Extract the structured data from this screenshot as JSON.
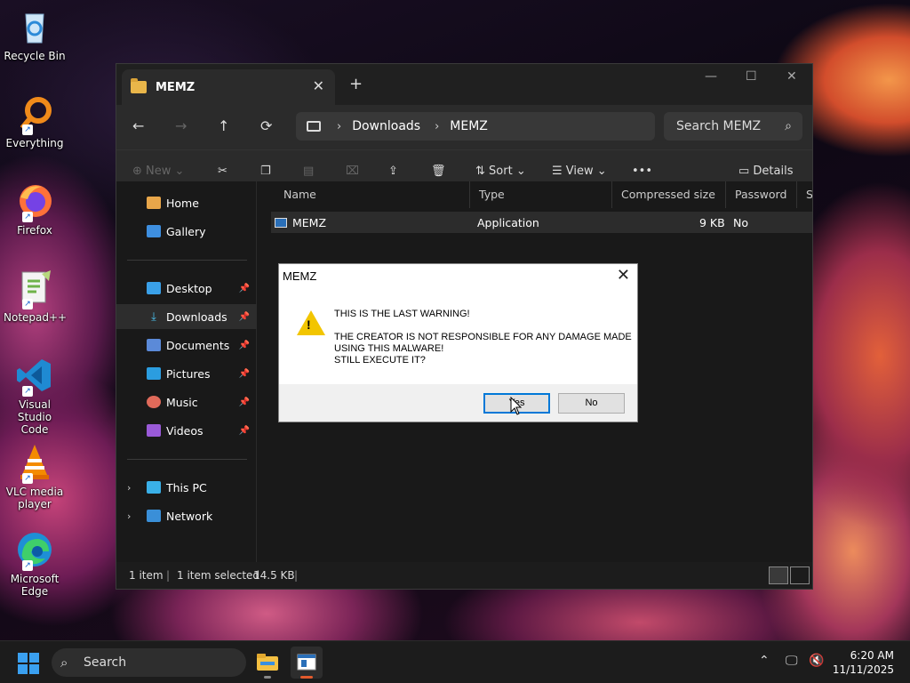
{
  "desktop": {
    "icons": [
      {
        "label": "Recycle Bin",
        "icon": "recycle-bin-icon"
      },
      {
        "label": "Everything",
        "icon": "everything-search-icon"
      },
      {
        "label": "Firefox",
        "icon": "firefox-icon"
      },
      {
        "label": "Notepad++",
        "icon": "notepad-plus-plus-icon"
      },
      {
        "label": "Visual Studio Code",
        "icon": "vscode-icon"
      },
      {
        "label": "VLC media player",
        "icon": "vlc-icon"
      },
      {
        "label": "Microsoft Edge",
        "icon": "edge-icon"
      }
    ]
  },
  "explorer": {
    "tab_title": "MEMZ",
    "new_tab": "+",
    "nav": {
      "back": "←",
      "forward": "→",
      "up": "↑",
      "refresh": "⟳"
    },
    "breadcrumb": [
      "Downloads",
      "MEMZ"
    ],
    "search_placeholder": "Search MEMZ",
    "toolbar": {
      "new_label": "New",
      "sort_label": "Sort",
      "view_label": "View",
      "more_label": "•••",
      "details_label": "Details"
    },
    "sidebar": {
      "home": "Home",
      "gallery": "Gallery",
      "quick_access": [
        {
          "label": "Desktop",
          "icon": "desktop-folder-icon"
        },
        {
          "label": "Downloads",
          "icon": "downloads-folder-icon"
        },
        {
          "label": "Documents",
          "icon": "documents-folder-icon"
        },
        {
          "label": "Pictures",
          "icon": "pictures-folder-icon"
        },
        {
          "label": "Music",
          "icon": "music-folder-icon"
        },
        {
          "label": "Videos",
          "icon": "videos-folder-icon"
        }
      ],
      "this_pc": "This PC",
      "network": "Network"
    },
    "columns": [
      "Name",
      "Type",
      "Compressed size",
      "Password ...",
      "Si"
    ],
    "files": [
      {
        "name": "MEMZ",
        "type": "Application",
        "compressed_size": "9 KB",
        "password": "No"
      }
    ],
    "status": {
      "count": "1 item",
      "selected": "1 item selected",
      "size": "14.5 KB"
    }
  },
  "dialog": {
    "title": "MEMZ",
    "message": "THIS IS THE LAST WARNING!\n\nTHE CREATOR IS NOT RESPONSIBLE FOR ANY DAMAGE MADE\nUSING THIS MALWARE!\nSTILL EXECUTE IT?",
    "yes_label": "Yes",
    "no_label": "No",
    "warning_mark": "!"
  },
  "taskbar": {
    "search_placeholder": "Search",
    "time": "6:20 AM",
    "date": "11/11/2025"
  },
  "colors": {
    "accent": "#0078d7",
    "taskbar_active_indicator": "#e35a2c",
    "warning": "#f2c500"
  }
}
